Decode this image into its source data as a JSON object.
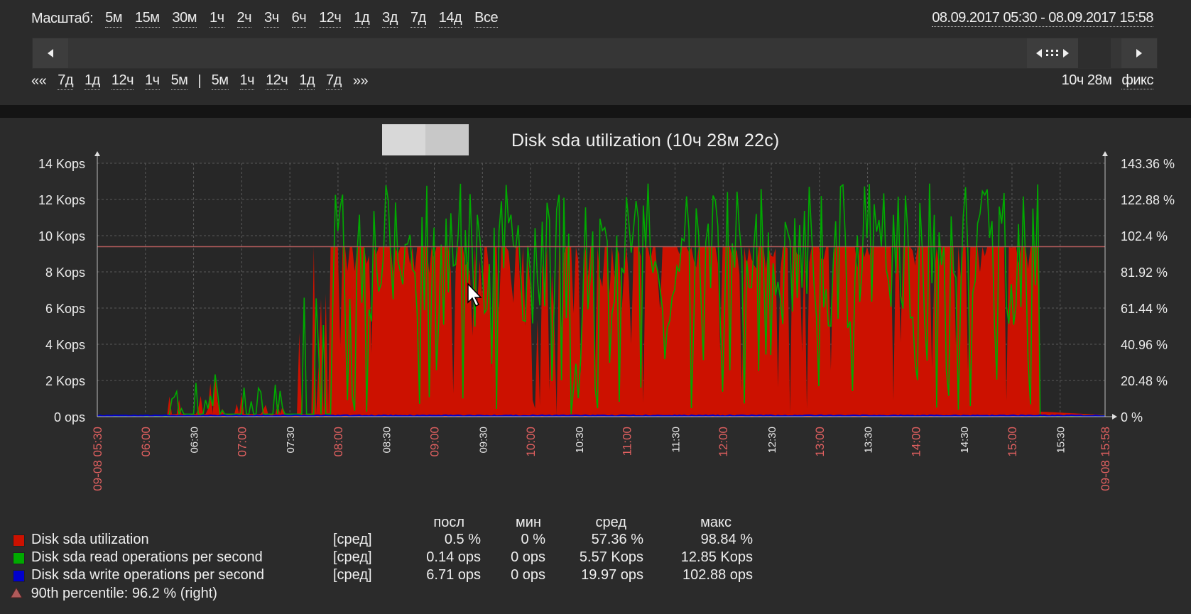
{
  "zoom": {
    "label": "Масштаб:",
    "options": [
      "5м",
      "15м",
      "30м",
      "1ч",
      "2ч",
      "3ч",
      "6ч",
      "12ч",
      "1д",
      "3д",
      "7д",
      "14д",
      "Все"
    ]
  },
  "period_range": "08.09.2017 05:30 - 08.09.2017 15:58",
  "nav": {
    "back_all": "««",
    "back": [
      "7д",
      "1д",
      "12ч",
      "1ч",
      "5м"
    ],
    "separator": "|",
    "forward": [
      "5м",
      "1ч",
      "12ч",
      "1д",
      "7д"
    ],
    "forward_all": "»»",
    "duration": "10ч 28м",
    "fixed": "фикс"
  },
  "graph": {
    "title": "Disk sda utilization (10ч 28м 22с)",
    "left_ticks": [
      "14 Kops",
      "12 Kops",
      "10 Kops",
      "8 Kops",
      "6 Kops",
      "4 Kops",
      "2 Kops",
      "0 ops"
    ],
    "right_ticks": [
      "143.36 %",
      "122.88 %",
      "102.4 %",
      "81.92 %",
      "61.44 %",
      "40.96 %",
      "20.48 %",
      "0 %"
    ],
    "x_ticks": [
      {
        "label": "09-08 05:30",
        "major": true
      },
      {
        "label": "06:00",
        "major": true
      },
      {
        "label": "06:30",
        "major": false
      },
      {
        "label": "07:00",
        "major": true
      },
      {
        "label": "07:30",
        "major": false
      },
      {
        "label": "08:00",
        "major": true
      },
      {
        "label": "08:30",
        "major": false
      },
      {
        "label": "09:00",
        "major": true
      },
      {
        "label": "09:30",
        "major": false
      },
      {
        "label": "10:00",
        "major": true
      },
      {
        "label": "10:30",
        "major": false
      },
      {
        "label": "11:00",
        "major": true
      },
      {
        "label": "11:30",
        "major": false
      },
      {
        "label": "12:00",
        "major": true
      },
      {
        "label": "12:30",
        "major": false
      },
      {
        "label": "13:00",
        "major": true
      },
      {
        "label": "13:30",
        "major": false
      },
      {
        "label": "14:00",
        "major": true
      },
      {
        "label": "14:30",
        "major": false
      },
      {
        "label": "15:00",
        "major": true
      },
      {
        "label": "15:30",
        "major": false
      },
      {
        "label": "09-08 15:58",
        "major": true
      }
    ],
    "percentile_value": 96.2,
    "colors": {
      "utilization": "#cc1100",
      "read": "#00aa00",
      "write": "#0000cc",
      "percentile": "#b05a5a",
      "major_tick": "#e06060",
      "minor_tick": "#e8e8e8"
    }
  },
  "legend": {
    "headers": {
      "last": "посл",
      "min": "мин",
      "avg": "сред",
      "max": "макс"
    },
    "items": [
      {
        "name": "Disk sda utilization",
        "func": "[сред]",
        "last": "0.5 %",
        "min": "0 %",
        "avg": "57.36 %",
        "max": "98.84 %",
        "color": "#cc1100"
      },
      {
        "name": "Disk sda read operations per second",
        "func": "[сред]",
        "last": "0.14 ops",
        "min": "0 ops",
        "avg": "5.57 Kops",
        "max": "12.85 Kops",
        "color": "#00aa00"
      },
      {
        "name": "Disk sda write operations per second",
        "func": "[сред]",
        "last": "6.71 ops",
        "min": "0 ops",
        "avg": "19.97 ops",
        "max": "102.88 ops",
        "color": "#0000cc"
      }
    ],
    "percentile_text": "90th percentile: 96.2 % (right)"
  }
}
